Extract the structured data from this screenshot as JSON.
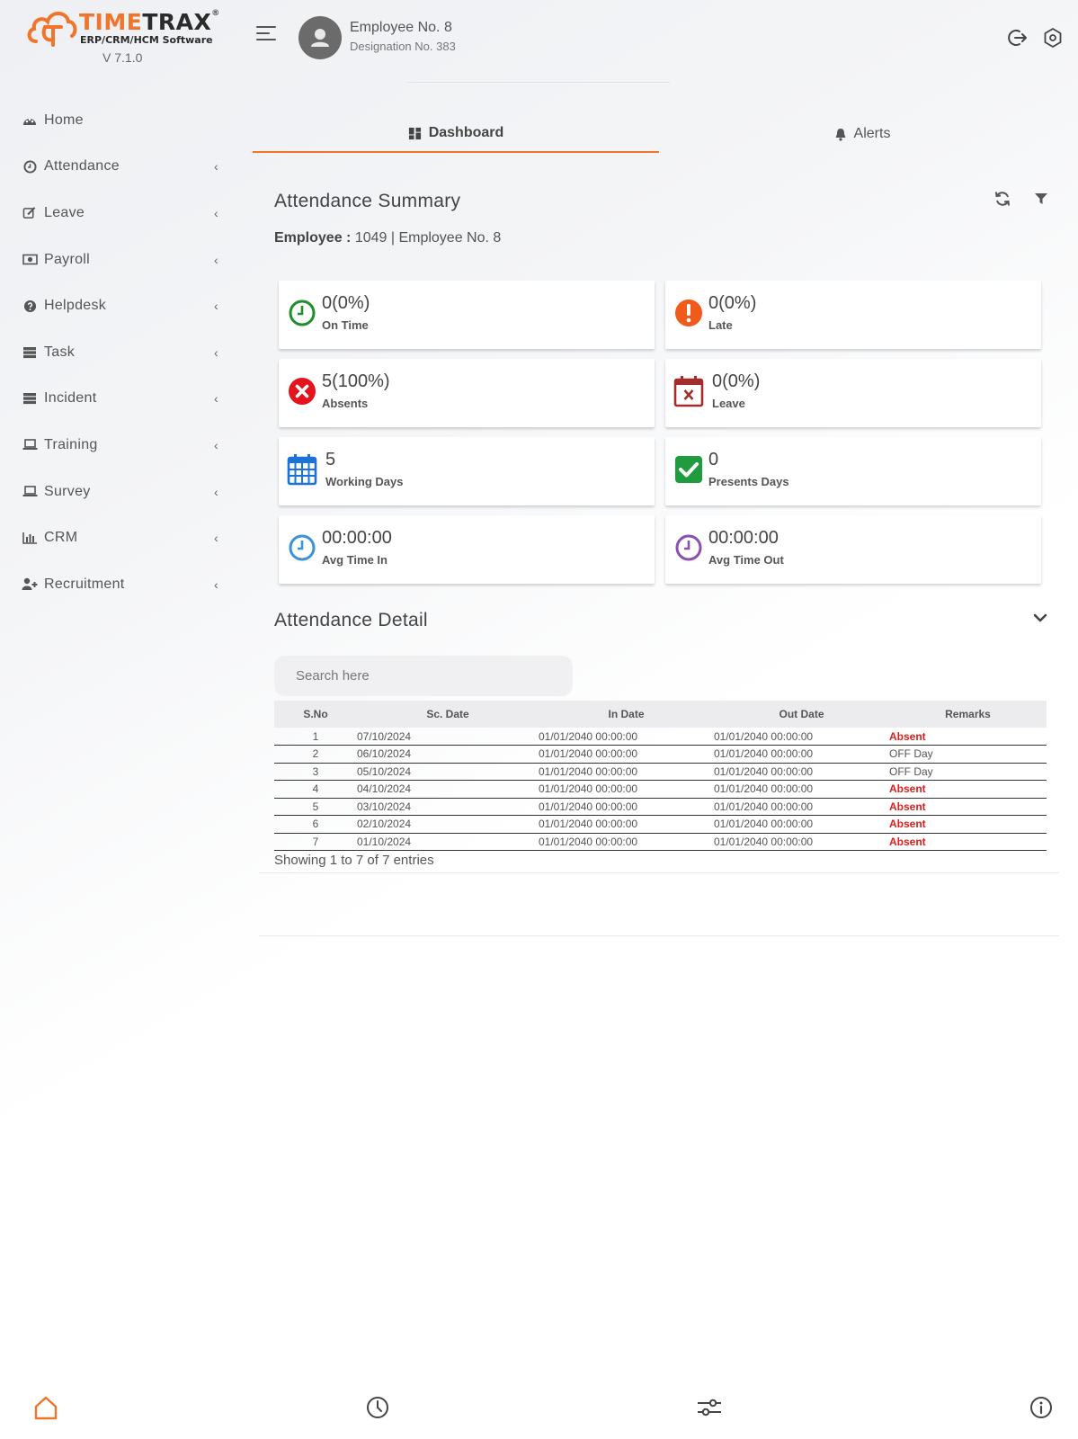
{
  "app": {
    "brand_part1": "TIME",
    "brand_part2": "TRAX",
    "trademark": "®",
    "tagline": "ERP/CRM/HCM Software",
    "version": "V 7.1.0",
    "accent_color": "#f0742a"
  },
  "user": {
    "name": "Employee No. 8",
    "designation": "Designation No. 383"
  },
  "sidebar": {
    "items": [
      {
        "label": "Home",
        "icon": "palette-icon",
        "has_submenu": false
      },
      {
        "label": "Attendance",
        "icon": "clock-icon",
        "has_submenu": true
      },
      {
        "label": "Leave",
        "icon": "edit-icon",
        "has_submenu": true
      },
      {
        "label": "Payroll",
        "icon": "money-icon",
        "has_submenu": true
      },
      {
        "label": "Helpdesk",
        "icon": "question-icon",
        "has_submenu": true
      },
      {
        "label": "Task",
        "icon": "server-icon",
        "has_submenu": true
      },
      {
        "label": "Incident",
        "icon": "server-icon",
        "has_submenu": true
      },
      {
        "label": "Training",
        "icon": "laptop-icon",
        "has_submenu": true
      },
      {
        "label": "Survey",
        "icon": "laptop-icon",
        "has_submenu": true
      },
      {
        "label": "CRM",
        "icon": "bar-chart-icon",
        "has_submenu": true
      },
      {
        "label": "Recruitment",
        "icon": "user-plus-icon",
        "has_submenu": true
      }
    ],
    "chevron": "‹"
  },
  "tabs": [
    {
      "label": "Dashboard",
      "active": true
    },
    {
      "label": "Alerts",
      "active": false
    }
  ],
  "summary": {
    "title": "Attendance Summary",
    "employee_label": "Employee :",
    "employee_value": "1049 | Employee No. 8",
    "cards": [
      {
        "value": "0(0%)",
        "label": "On Time",
        "icon": "clock-green-icon",
        "color": "#1e8f2a"
      },
      {
        "value": "0(0%)",
        "label": "Late",
        "icon": "exclamation-icon",
        "color": "#f05a1a"
      },
      {
        "value": "5(100%)",
        "label": "Absents",
        "icon": "times-circle-icon",
        "color": "#e5141c"
      },
      {
        "value": "0(0%)",
        "label": "Leave",
        "icon": "calendar-x-icon",
        "color": "#a32d2d"
      },
      {
        "value": "5",
        "label": "Working Days",
        "icon": "calendar-icon",
        "color": "#1a73d9"
      },
      {
        "value": "0",
        "label": "Presents Days",
        "icon": "check-square-icon",
        "color": "#1e9c3e"
      },
      {
        "value": "00:00:00",
        "label": "Avg Time In",
        "icon": "clock-blue-icon",
        "color": "#3a92d8"
      },
      {
        "value": "00:00:00",
        "label": "Avg Time Out",
        "icon": "clock-purple-icon",
        "color": "#8a4fb0"
      }
    ]
  },
  "detail": {
    "title": "Attendance Detail",
    "search_placeholder": "Search here",
    "columns": [
      "S.No",
      "Sc. Date",
      "In Date",
      "Out Date",
      "Remarks"
    ],
    "rows": [
      [
        "1",
        "07/10/2024",
        "01/01/2040 00:00:00",
        "01/01/2040 00:00:00",
        "Absent"
      ],
      [
        "2",
        "06/10/2024",
        "01/01/2040 00:00:00",
        "01/01/2040 00:00:00",
        "OFF Day"
      ],
      [
        "3",
        "05/10/2024",
        "01/01/2040 00:00:00",
        "01/01/2040 00:00:00",
        "OFF Day"
      ],
      [
        "4",
        "04/10/2024",
        "01/01/2040 00:00:00",
        "01/01/2040 00:00:00",
        "Absent"
      ],
      [
        "5",
        "03/10/2024",
        "01/01/2040 00:00:00",
        "01/01/2040 00:00:00",
        "Absent"
      ],
      [
        "6",
        "02/10/2024",
        "01/01/2040 00:00:00",
        "01/01/2040 00:00:00",
        "Absent"
      ],
      [
        "7",
        "01/10/2024",
        "01/01/2040 00:00:00",
        "01/01/2040 00:00:00",
        "Absent"
      ]
    ],
    "footer": "Showing 1 to 7 of 7 entries"
  },
  "bottom_nav": [
    {
      "icon": "home-icon",
      "active": true
    },
    {
      "icon": "clock-icon",
      "active": false
    },
    {
      "icon": "sliders-icon",
      "active": false
    },
    {
      "icon": "info-icon",
      "active": false
    }
  ]
}
